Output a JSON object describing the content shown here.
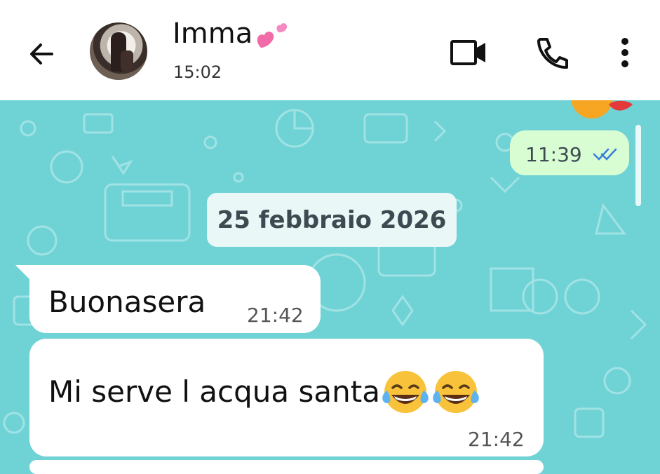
{
  "header": {
    "contact_name": "Imma",
    "status": "15:02",
    "back_label": "Back",
    "video_label": "Video call",
    "call_label": "Voice call",
    "more_label": "More options"
  },
  "chat": {
    "outgoing": [
      {
        "time": "11:39",
        "status": "read"
      }
    ],
    "date_separator": "25 febbraio 2026",
    "incoming": [
      {
        "text": "Buonasera",
        "time": "21:42"
      },
      {
        "text": "Mi serve l acqua santa",
        "emojis": [
          "face-with-tears-of-joy",
          "face-with-tears-of-joy"
        ],
        "time": "21:42"
      }
    ]
  },
  "colors": {
    "chat_background": "#6fd3d6",
    "outgoing_bubble": "#d9fdd3",
    "incoming_bubble": "#ffffff",
    "read_ticks": "#3b7fd9"
  }
}
